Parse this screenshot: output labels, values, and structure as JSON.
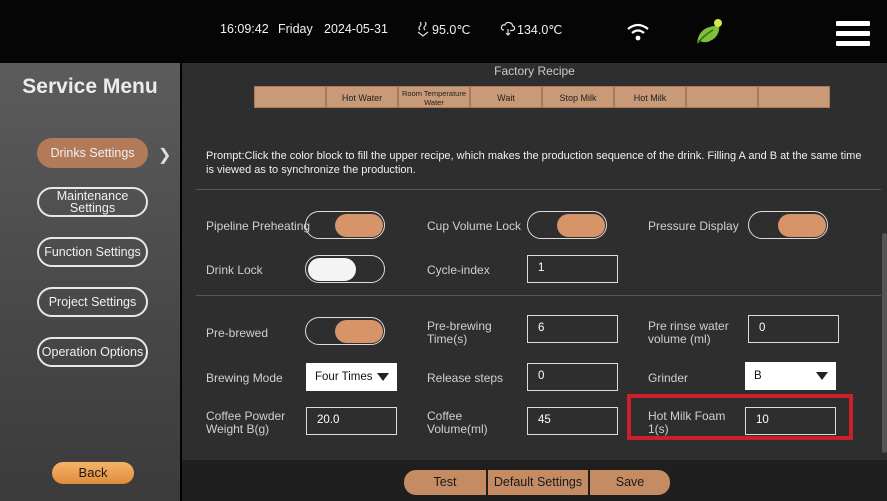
{
  "status_bar": {
    "time": "16:09:42",
    "weekday": "Friday",
    "date": "2024-05-31",
    "temp1": "95.0℃",
    "temp2": "134.0℃",
    "icons": [
      "steam-icon",
      "cloud-icon",
      "wifi-icon",
      "leaf-icon",
      "menu-icon"
    ]
  },
  "sidebar": {
    "title": "Service Menu",
    "items": [
      {
        "label": "Drinks Settings",
        "active": true
      },
      {
        "label": "Maintenance Settings"
      },
      {
        "label": "Function Settings"
      },
      {
        "label": "Project Settings"
      },
      {
        "label": "Operation Options"
      }
    ],
    "back_label": "Back"
  },
  "recipe": {
    "title": "Factory Recipe",
    "cells": [
      "",
      "Hot Water",
      "Room Temperature Water",
      "Wait",
      "Stop Milk",
      "Hot Milk",
      "",
      ""
    ]
  },
  "prompt": "Prompt:Click the color block to fill the upper recipe, which makes the production sequence of the drink. Filling A and B at the same time is viewed as to synchronize the production.",
  "settings": {
    "pipeline_preheating": {
      "label": "Pipeline Preheating",
      "on": true
    },
    "cup_volume_lock": {
      "label": "Cup Volume Lock",
      "on": true
    },
    "pressure_display": {
      "label": "Pressure Display",
      "on": true
    },
    "drink_lock": {
      "label": "Drink Lock",
      "on": false
    },
    "cycle_index": {
      "label": "Cycle-index",
      "value": "1"
    },
    "pre_brewed": {
      "label": "Pre-brewed",
      "on": true
    },
    "pre_brewing_time": {
      "label": "Pre-brewing Time(s)",
      "value": "6"
    },
    "pre_rinse_water": {
      "label": "Pre rinse water volume (ml)",
      "value": "0"
    },
    "brewing_mode": {
      "label": "Brewing Mode",
      "value": "Four Times"
    },
    "release_steps": {
      "label": "Release steps",
      "value": "0"
    },
    "grinder": {
      "label": "Grinder",
      "value": "B"
    },
    "coffee_powder_weight": {
      "label": "Coffee Powder Weight B(g)",
      "value": "20.0"
    },
    "coffee_volume": {
      "label": "Coffee Volume(ml)",
      "value": "45"
    },
    "hot_milk_foam": {
      "label": "Hot Milk Foam 1(s)",
      "value": "10"
    }
  },
  "bottom": {
    "test_label": "Test",
    "default_label": "Default Settings",
    "save_label": "Save"
  },
  "colors": {
    "accent": "#c58c63",
    "toggle_on": "#d69468",
    "highlight": "#cc1f2a",
    "back_button": "#f0a050"
  }
}
